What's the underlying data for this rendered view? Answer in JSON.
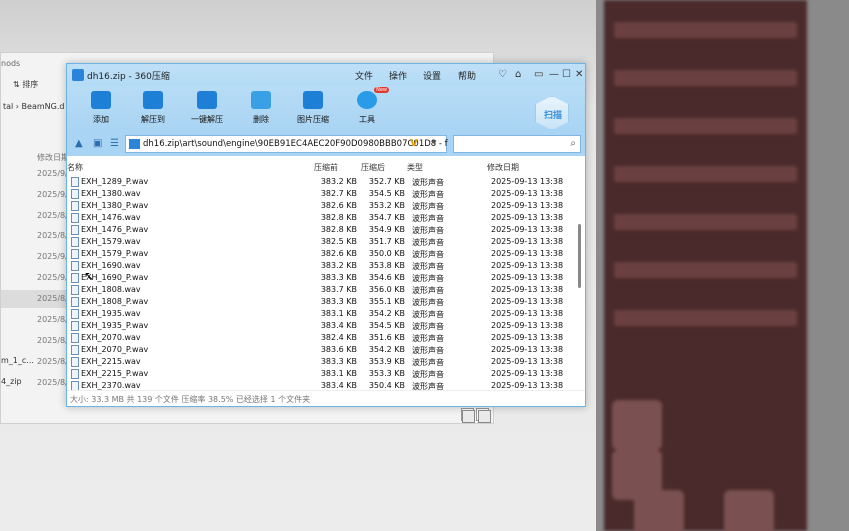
{
  "background_explorer": {
    "top_text": "nods",
    "sort_label": "排序",
    "address": "tal  ›  BeamNG.d",
    "column_date": "修改日期",
    "dates": [
      "2025/9/",
      "2025/9/",
      "2025/8/",
      "2025/8/",
      "2025/9/",
      "2025/9/",
      "2025/8/",
      "2025/8/",
      "2025/8/",
      "2025/8/",
      "2025/8/"
    ],
    "items": [
      "m_1_c...",
      "4_zip"
    ]
  },
  "zip_window": {
    "title": "dh16.zip - 360压缩",
    "menu": [
      "文件",
      "操作",
      "设置",
      "帮助"
    ],
    "toolbar": [
      {
        "label": "添加",
        "icon": "add-icon"
      },
      {
        "label": "解压到",
        "icon": "extract-to-icon"
      },
      {
        "label": "一键解压",
        "icon": "one-click-extract-icon"
      },
      {
        "label": "删除",
        "icon": "delete-icon"
      },
      {
        "label": "图片压缩",
        "icon": "image-compress-icon"
      },
      {
        "label": "工具",
        "icon": "tools-icon",
        "badge": "New"
      }
    ],
    "scan_label": "扫描",
    "path": "dh16.zip\\art\\sound\\engine\\90EB91EC4AEC20F90D0980BBB07C01D8 - f",
    "search_placeholder": "",
    "columns": {
      "name": "名称",
      "compressed": "压缩前",
      "original": "压缩后",
      "type": "类型",
      "date": "修改日期"
    },
    "files": [
      {
        "name": "EXH_1289_P.wav",
        "compressed": "383.2 KB",
        "original": "352.7 KB",
        "type": "波形声音",
        "date": "2025-09-13 13:38"
      },
      {
        "name": "EXH_1380.wav",
        "compressed": "382.7 KB",
        "original": "354.5 KB",
        "type": "波形声音",
        "date": "2025-09-13 13:38"
      },
      {
        "name": "EXH_1380_P.wav",
        "compressed": "382.6 KB",
        "original": "353.2 KB",
        "type": "波形声音",
        "date": "2025-09-13 13:38"
      },
      {
        "name": "EXH_1476.wav",
        "compressed": "382.8 KB",
        "original": "354.7 KB",
        "type": "波形声音",
        "date": "2025-09-13 13:38"
      },
      {
        "name": "EXH_1476_P.wav",
        "compressed": "382.8 KB",
        "original": "354.9 KB",
        "type": "波形声音",
        "date": "2025-09-13 13:38"
      },
      {
        "name": "EXH_1579.wav",
        "compressed": "382.5 KB",
        "original": "351.7 KB",
        "type": "波形声音",
        "date": "2025-09-13 13:38"
      },
      {
        "name": "EXH_1579_P.wav",
        "compressed": "382.6 KB",
        "original": "350.0 KB",
        "type": "波形声音",
        "date": "2025-09-13 13:38"
      },
      {
        "name": "EXH_1690.wav",
        "compressed": "383.2 KB",
        "original": "353.8 KB",
        "type": "波形声音",
        "date": "2025-09-13 13:38"
      },
      {
        "name": "EXH_1690_P.wav",
        "compressed": "383.3 KB",
        "original": "354.6 KB",
        "type": "波形声音",
        "date": "2025-09-13 13:38"
      },
      {
        "name": "EXH_1808.wav",
        "compressed": "383.7 KB",
        "original": "356.0 KB",
        "type": "波形声音",
        "date": "2025-09-13 13:38"
      },
      {
        "name": "EXH_1808_P.wav",
        "compressed": "383.3 KB",
        "original": "355.1 KB",
        "type": "波形声音",
        "date": "2025-09-13 13:38"
      },
      {
        "name": "EXH_1935.wav",
        "compressed": "383.1 KB",
        "original": "354.2 KB",
        "type": "波形声音",
        "date": "2025-09-13 13:38"
      },
      {
        "name": "EXH_1935_P.wav",
        "compressed": "383.4 KB",
        "original": "354.5 KB",
        "type": "波形声音",
        "date": "2025-09-13 13:38"
      },
      {
        "name": "EXH_2070.wav",
        "compressed": "382.4 KB",
        "original": "351.6 KB",
        "type": "波形声音",
        "date": "2025-09-13 13:38"
      },
      {
        "name": "EXH_2070_P.wav",
        "compressed": "383.6 KB",
        "original": "354.2 KB",
        "type": "波形声音",
        "date": "2025-09-13 13:38"
      },
      {
        "name": "EXH_2215.wav",
        "compressed": "383.3 KB",
        "original": "353.9 KB",
        "type": "波形声音",
        "date": "2025-09-13 13:38"
      },
      {
        "name": "EXH_2215_P.wav",
        "compressed": "383.1 KB",
        "original": "353.3 KB",
        "type": "波形声音",
        "date": "2025-09-13 13:38"
      },
      {
        "name": "EXH_2370.wav",
        "compressed": "383.4 KB",
        "original": "350.4 KB",
        "type": "波形声音",
        "date": "2025-09-13 13:38"
      }
    ],
    "status": "大小: 33.3 MB 共 139 个文件 压缩率 38.5% 已经选择 1 个文件夹"
  },
  "colors": {
    "accent": "#2a84d8",
    "toolbar_bg": "#a9d4f3",
    "badge": "#e03a2e"
  }
}
